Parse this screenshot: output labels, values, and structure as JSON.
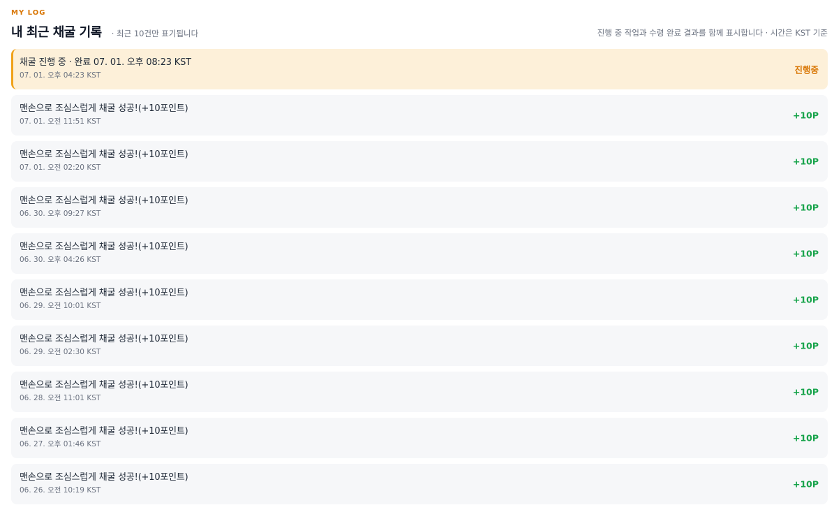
{
  "header": {
    "eyebrow": "MY LOG",
    "title": "내 최근 채굴 기록",
    "subtitle": "· 최근 10건만 표기됩니다",
    "note": "진행 중 작업과 수령 완료 결과를 함께 표시합니다 · 시간은 KST 기준"
  },
  "colors": {
    "accent": "#d97706",
    "pending_bg": "#fdf0d9",
    "pending_border": "#f0a21a",
    "points": "#16a34a",
    "row_bg": "#f6f7f9"
  },
  "log": [
    {
      "status": "pending",
      "message": "채굴 진행 중 · 완료 07. 01. 오후 08:23 KST",
      "time": "07. 01. 오후 04:23 KST",
      "badge": "진행중"
    },
    {
      "status": "done",
      "message": "맨손으로 조심스럽게 채굴 성공!(+10포인트)",
      "time": "07. 01. 오전 11:51 KST",
      "badge": "+10P"
    },
    {
      "status": "done",
      "message": "맨손으로 조심스럽게 채굴 성공!(+10포인트)",
      "time": "07. 01. 오전 02:20 KST",
      "badge": "+10P"
    },
    {
      "status": "done",
      "message": "맨손으로 조심스럽게 채굴 성공!(+10포인트)",
      "time": "06. 30. 오후 09:27 KST",
      "badge": "+10P"
    },
    {
      "status": "done",
      "message": "맨손으로 조심스럽게 채굴 성공!(+10포인트)",
      "time": "06. 30. 오후 04:26 KST",
      "badge": "+10P"
    },
    {
      "status": "done",
      "message": "맨손으로 조심스럽게 채굴 성공!(+10포인트)",
      "time": "06. 29. 오전 10:01 KST",
      "badge": "+10P"
    },
    {
      "status": "done",
      "message": "맨손으로 조심스럽게 채굴 성공!(+10포인트)",
      "time": "06. 29. 오전 02:30 KST",
      "badge": "+10P"
    },
    {
      "status": "done",
      "message": "맨손으로 조심스럽게 채굴 성공!(+10포인트)",
      "time": "06. 28. 오전 11:01 KST",
      "badge": "+10P"
    },
    {
      "status": "done",
      "message": "맨손으로 조심스럽게 채굴 성공!(+10포인트)",
      "time": "06. 27. 오후 01:46 KST",
      "badge": "+10P"
    },
    {
      "status": "done",
      "message": "맨손으로 조심스럽게 채굴 성공!(+10포인트)",
      "time": "06. 26. 오전 10:19 KST",
      "badge": "+10P"
    }
  ]
}
